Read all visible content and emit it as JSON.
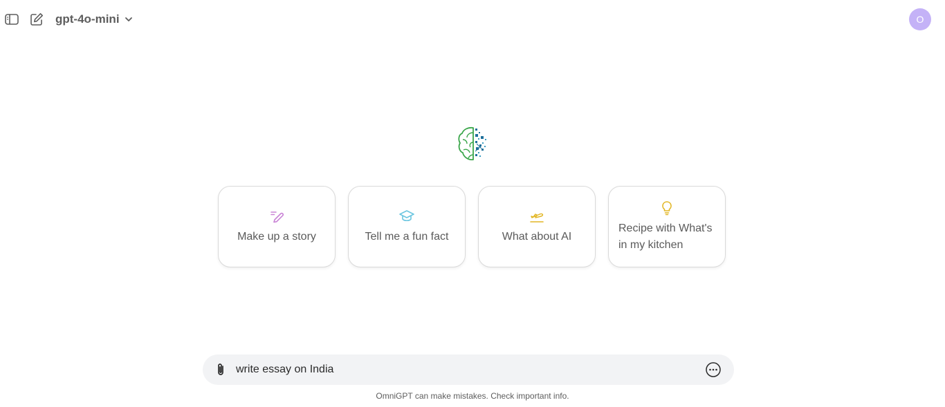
{
  "header": {
    "model_name": "gpt-4o-mini",
    "avatar_initial": "O"
  },
  "icons": {
    "sidebar": "sidebar-toggle-icon",
    "new_chat": "edit-icon",
    "model_dropdown": "chevron-down-icon",
    "logo": "brain-circuit-logo",
    "attach": "paperclip-icon",
    "more": "ellipsis-circle-icon"
  },
  "suggestions": [
    {
      "label": "Make up a story",
      "icon": "pen-icon",
      "color": "#c983d6"
    },
    {
      "label": "Tell me a fun fact",
      "icon": "graduation-cap-icon",
      "color": "#6cc6e0"
    },
    {
      "label": "What about AI",
      "icon": "plane-icon",
      "color": "#e2b624"
    },
    {
      "label": "Recipe with What's in my kitchen",
      "icon": "lightbulb-icon",
      "color": "#e2b624"
    }
  ],
  "composer": {
    "value": "write essay on India"
  },
  "footer": {
    "disclaimer": "OmniGPT can make mistakes. Check important info."
  },
  "colors": {
    "avatar_bg": "#c4b2f7",
    "composer_bg": "#f2f3f5",
    "logo_green": "#3aa64a",
    "logo_blue": "#1e6f9a"
  }
}
